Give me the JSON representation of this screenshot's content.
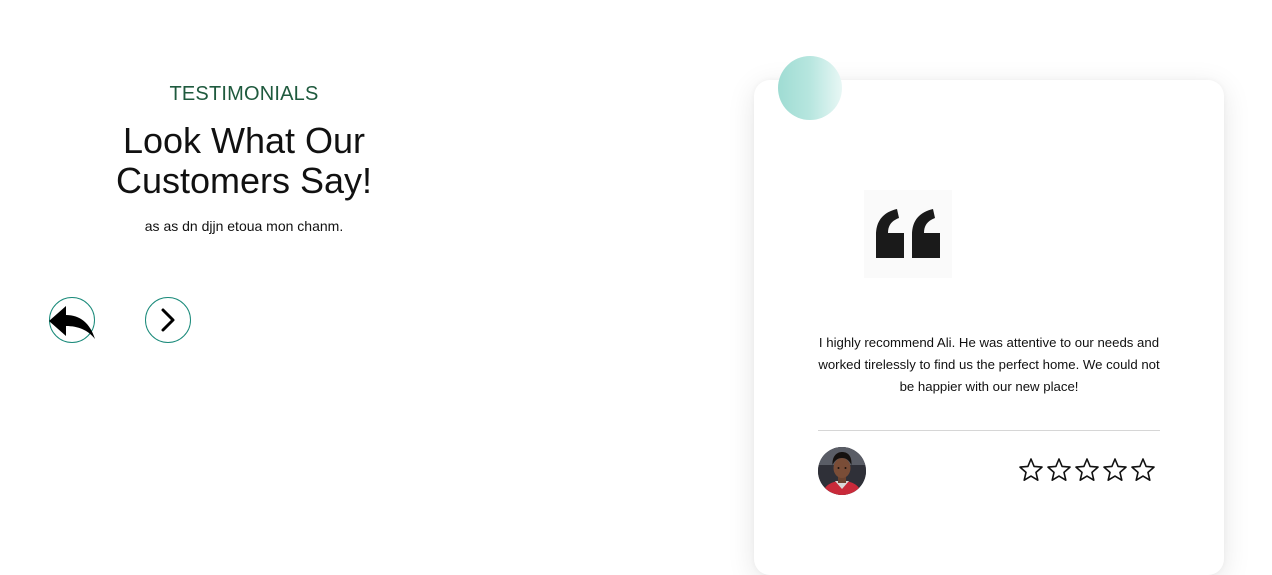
{
  "intro": {
    "eyebrow": "TESTIMONIALS",
    "headline_line1": "Look What Our",
    "headline_line2": "Customers Say!",
    "subtext": "as as dn djjn etoua mon chanm."
  },
  "navigation": {
    "prev_icon": "reply-arrow-icon",
    "next_icon": "chevron-right-icon"
  },
  "testimonial": {
    "quote_icon": "quote-icon",
    "text": "I highly recommend Ali. He was attentive to our needs and worked tirelessly to find us the perfect home. We could not be happier with our new place!",
    "author_avatar": "avatar-photo",
    "rating": {
      "value": 0,
      "max": 5,
      "icon": "star-outline-icon"
    }
  },
  "colors": {
    "eyebrow": "#1f5a3e",
    "nav_border": "#1a8a7a",
    "bubble_gradient": [
      "#9fdcd3",
      "#e8f7f5"
    ],
    "text": "#111111",
    "quote_mark": "#1a1a1a",
    "divider": "#d6d6d6"
  }
}
